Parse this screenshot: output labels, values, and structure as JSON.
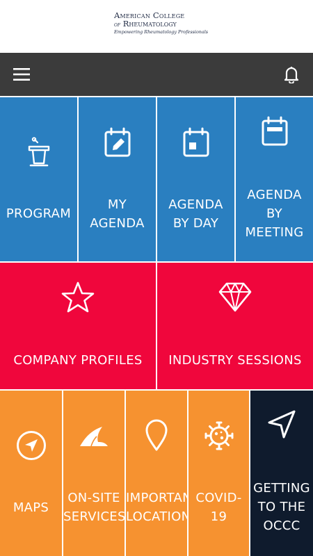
{
  "header": {
    "logo_line1": "American College",
    "logo_of": "of",
    "logo_line2": "Rheumatology",
    "logo_tagline": "Empowering Rheumatology Professionals"
  },
  "nav": {
    "menu_icon": "hamburger-icon",
    "bell_icon": "bell-icon"
  },
  "tiles_row1": [
    {
      "label": "PROGRAM",
      "icon": "podium-icon"
    },
    {
      "label_lines": [
        "MY",
        "AGENDA"
      ],
      "icon": "calendar-edit-icon"
    },
    {
      "label_lines": [
        "AGENDA",
        "BY DAY"
      ],
      "icon": "calendar-day-icon"
    },
    {
      "label_lines": [
        "AGENDA",
        "BY",
        "MEETING"
      ],
      "icon": "calendar-icon"
    }
  ],
  "tiles_row2": [
    {
      "label": "COMPANY PROFILES",
      "icon": "star-icon"
    },
    {
      "label": "INDUSTRY SESSIONS",
      "icon": "diamond-icon"
    }
  ],
  "tiles_row3": [
    {
      "label": "MAPS",
      "icon": "compass-icon"
    },
    {
      "label_lines": [
        "ON-SITE",
        "SERVICES"
      ],
      "icon": "shark-fin-icon"
    },
    {
      "label_lines": [
        "IMPORTANT",
        "LOCATIONS"
      ],
      "icon": "map-pin-icon"
    },
    {
      "label_lines": [
        "COVID-",
        "19"
      ],
      "icon": "virus-icon"
    },
    {
      "label_lines": [
        "GETTING",
        "TO THE",
        "OCCC"
      ],
      "icon": "navigation-arrow-icon"
    }
  ],
  "colors": {
    "nav_bg": "#3b3b3b",
    "blue": "#2a7fc0",
    "red": "#f0063c",
    "orange": "#f69230",
    "navy": "#0f1b2d"
  }
}
